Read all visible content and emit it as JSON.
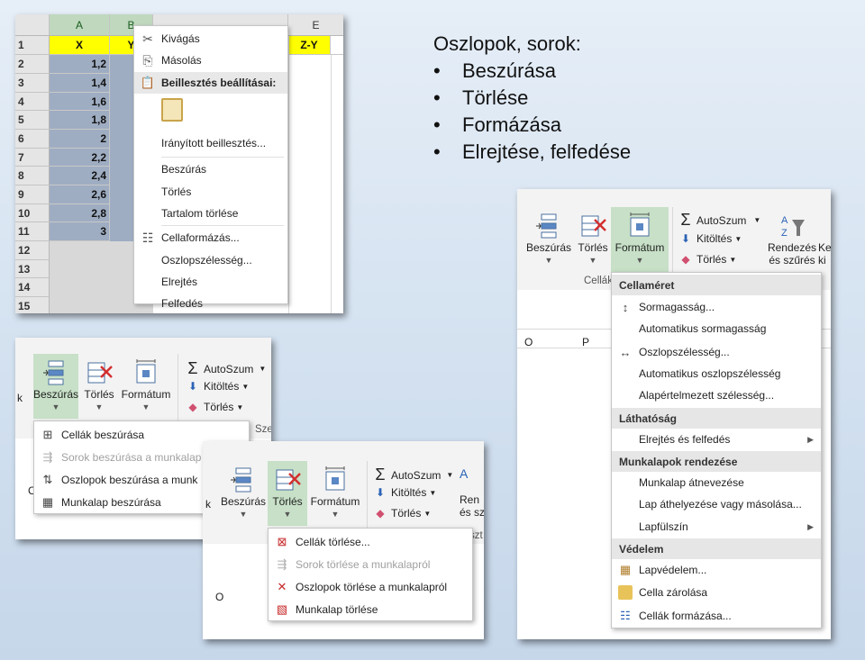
{
  "slide": {
    "title": "Oszlopok, sorok:",
    "bullets": [
      "Beszúrása",
      "Törlése",
      "Formázása",
      "Elrejtése, felfedése"
    ]
  },
  "sheet": {
    "columns": [
      "A",
      "B",
      "E"
    ],
    "header_row": {
      "A": "X",
      "B": "Y",
      "E": "Z-Y"
    },
    "rows": [
      "1",
      "2",
      "3",
      "4",
      "5",
      "6",
      "7",
      "8",
      "9",
      "10",
      "11",
      "12",
      "13",
      "14",
      "15"
    ],
    "x_values": [
      "1,2",
      "1,4",
      "1,6",
      "1,8",
      "2",
      "2,2",
      "2,4",
      "2,6",
      "2,8",
      "3"
    ],
    "context_menu": {
      "cut": "Kivágás",
      "copy": "Másolás",
      "paste_options": "Beillesztés beállításai:",
      "paste_special": "Irányított beillesztés...",
      "insert": "Beszúrás",
      "delete": "Törlés",
      "clear_contents": "Tartalom törlése",
      "format_cells": "Cellaformázás...",
      "column_width": "Oszlopszélesség...",
      "hide": "Elrejtés",
      "unhide": "Felfedés"
    }
  },
  "ribbon_insert": {
    "prev_group_label": "k",
    "insert_label": "Beszúrás",
    "delete_label": "Törlés",
    "format_label": "Formátum",
    "autosum": "AutoSzum",
    "fill": "Kitöltés",
    "clear": "Törlés",
    "group_caption": "Sze",
    "menu": {
      "insert_cells": "Cellák beszúrása",
      "insert_rows": "Sorok beszúrása a munkalap",
      "insert_cols": "Oszlopok beszúrása a munk",
      "insert_sheet": "Munkalap beszúrása"
    },
    "sheet_col": "C"
  },
  "ribbon_delete": {
    "prev_group_label": "k",
    "insert_label": "Beszúrás",
    "delete_label": "Törlés",
    "format_label": "Formátum",
    "autosum": "AutoSzum",
    "fill": "Kitöltés",
    "clear": "Törlés",
    "sort_label_1": "Ren",
    "sort_label_2": "és sz",
    "group_caption": "szt",
    "col_o": "O",
    "menu": {
      "delete_cells": "Cellák törlése...",
      "delete_rows": "Sorok törlése a munkalapról",
      "delete_cols": "Oszlopok törlése a munkalapról",
      "delete_sheet": "Munkalap törlése"
    }
  },
  "ribbon_format": {
    "insert_label": "Beszúrás",
    "delete_label": "Törlés",
    "format_label": "Formátum",
    "autosum": "AutoSzum",
    "fill": "Kitöltés",
    "clear": "Törlés",
    "sort_label_1": "Rendezés",
    "sort_label_2": "és szűrés",
    "cut_label_1": "Ke",
    "cut_label_2": "ki",
    "group_caption": "Cellák",
    "col_o": "O",
    "col_p": "P",
    "menu": {
      "head_cellsize": "Cellaméret",
      "row_height": "Sormagasság...",
      "autofit_row": "Automatikus sormagasság",
      "col_width": "Oszlopszélesség...",
      "autofit_col": "Automatikus oszlopszélesség",
      "default_width": "Alapértelmezett szélesség...",
      "head_visibility": "Láthatóság",
      "hide_unhide": "Elrejtés és felfedés",
      "head_organize": "Munkalapok rendezése",
      "rename_sheet": "Munkalap átnevezése",
      "move_copy": "Lap áthelyezése vagy másolása...",
      "tab_color": "Lapfülszín",
      "head_protection": "Védelem",
      "protect_sheet": "Lapvédelem...",
      "lock_cell": "Cella zárolása",
      "format_cells": "Cellák formázása..."
    }
  }
}
